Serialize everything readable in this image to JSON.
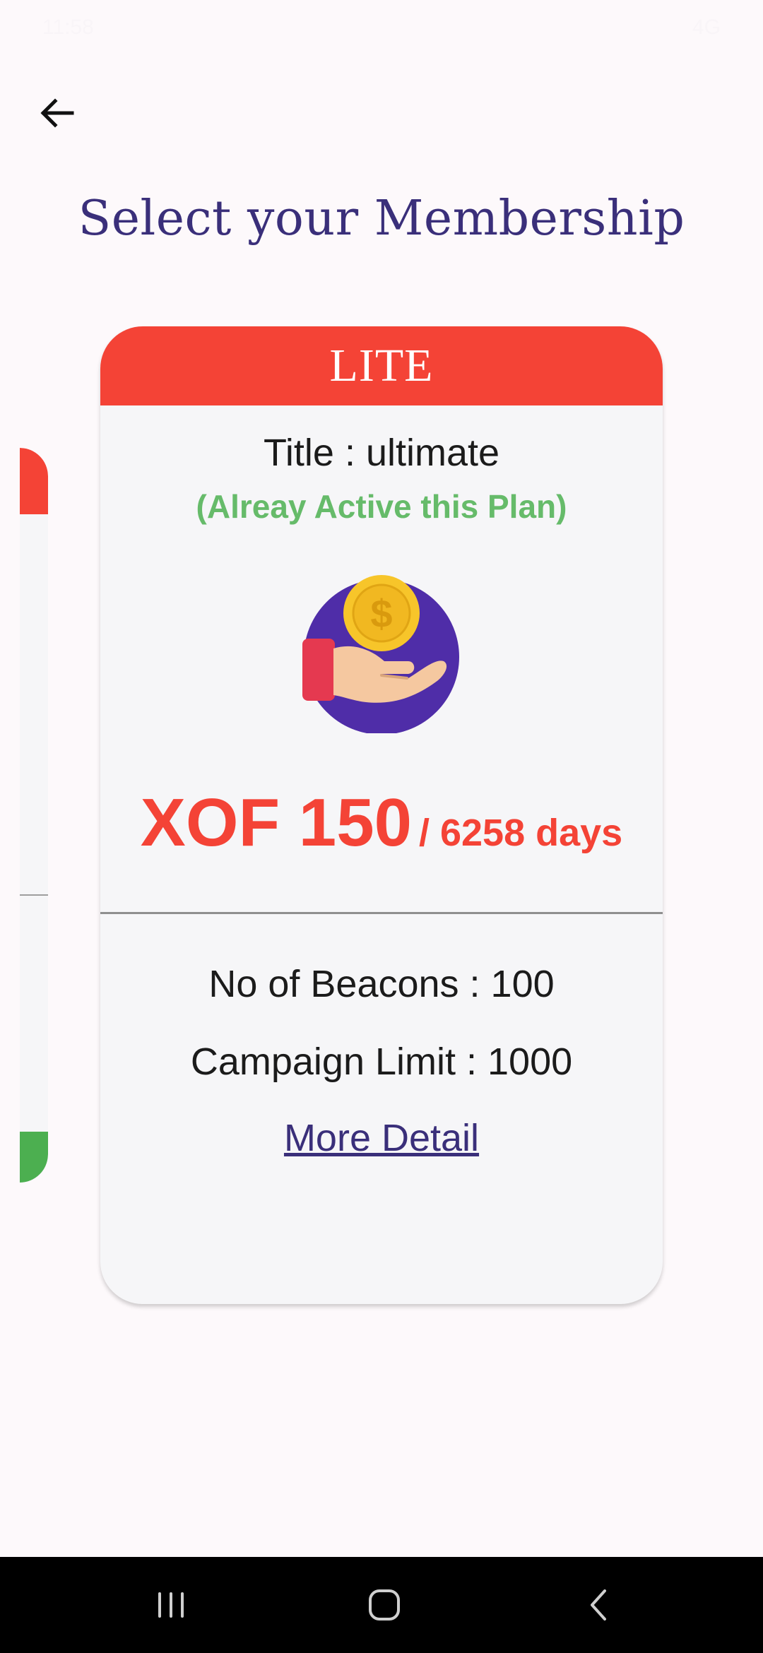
{
  "status_bar": {
    "time": "11:58",
    "indicators": "4G"
  },
  "header": {
    "back_icon": "arrow-left-icon",
    "title": "Select your Membership"
  },
  "plan": {
    "name": "LITE",
    "title": "Title : ultimate",
    "active_note": "(Alreay Active this Plan)",
    "icon": "hand-holding-coin-icon",
    "price": "XOF 150",
    "period": "/ 6258 days",
    "features": [
      "No of Beacons : 100",
      "Campaign Limit : 1000"
    ],
    "more_detail": "More Detail"
  },
  "colors": {
    "accent_red": "#f44336",
    "active_green": "#66bb6a",
    "title_purple": "#3a2f7a",
    "card_bg": "#f6f6f8",
    "peek_green": "#4caf50"
  },
  "nav_bar": {
    "recent_icon": "recent-apps-icon",
    "home_icon": "home-icon",
    "back_icon": "back-chevron-icon"
  }
}
